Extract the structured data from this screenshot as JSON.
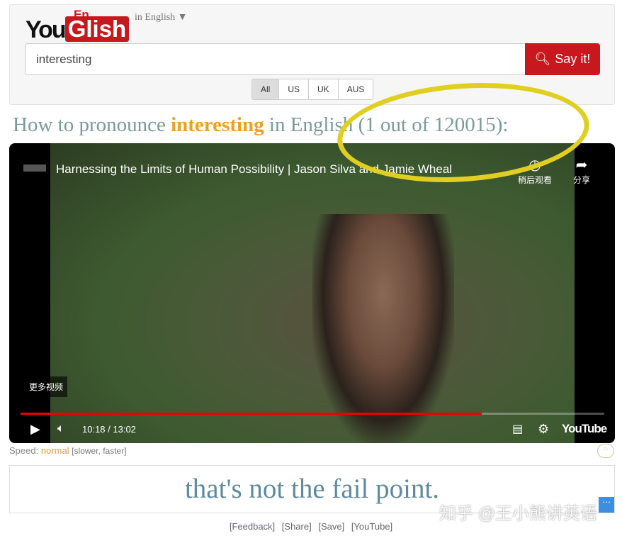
{
  "logo": {
    "you": "You",
    "en": "En",
    "glish": "Glish"
  },
  "language": "in English ▼",
  "search": {
    "value": "interesting",
    "button": "Say it!"
  },
  "accents": [
    "All",
    "US",
    "UK",
    "AUS"
  ],
  "heading": {
    "prefix": "How to pronounce ",
    "word": "interesting",
    "suffix": " in English (1 out of 120015):"
  },
  "video": {
    "title": "Harnessing the Limits of Human Possibility | Jason Silva and Jamie Wheal",
    "watch_later": "稍后观看",
    "share": "分享",
    "more_videos": "更多视频",
    "time": "10:18 / 13:02",
    "progress_percent": 79,
    "brand": "YouTube"
  },
  "speed": {
    "label": "Speed: ",
    "value": "normal",
    "options": "[slower, faster]"
  },
  "caption": "that's not the fail point.",
  "links": [
    "[Feedback]",
    "[Share]",
    "[Save]",
    "[YouTube]"
  ],
  "watermark": "知乎 @王小熊讲英语",
  "colors": {
    "brand_red": "#c9171e",
    "highlight": "#f0a020",
    "annotation": "#e0cf20"
  }
}
